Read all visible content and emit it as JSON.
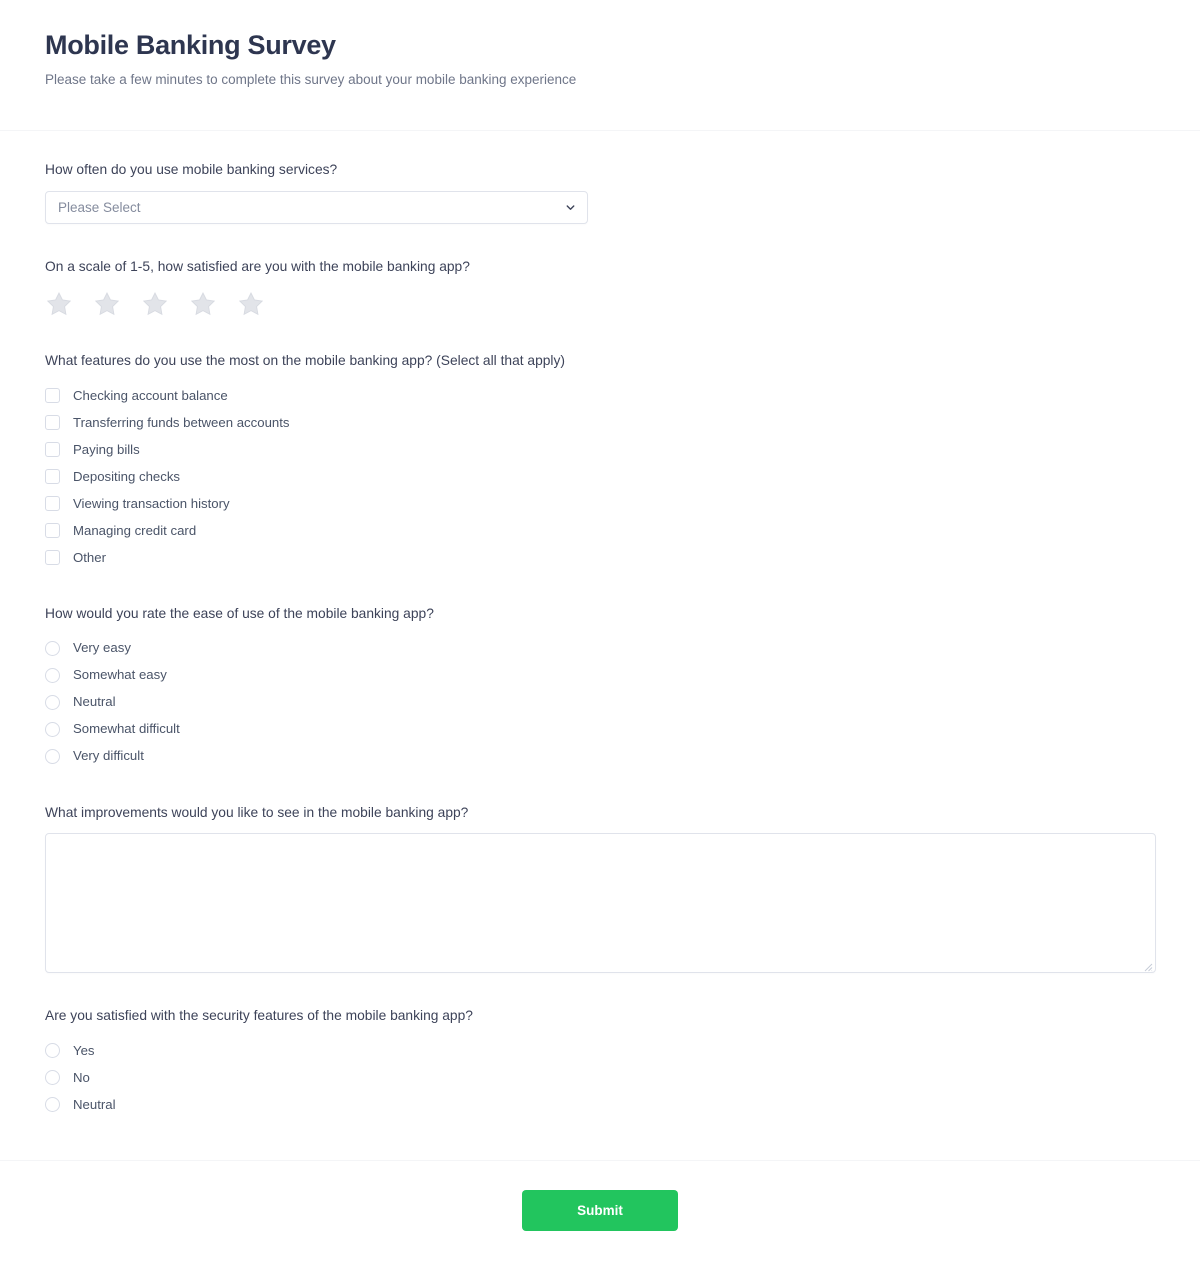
{
  "header": {
    "title": "Mobile Banking Survey",
    "subtitle": "Please take a few minutes to complete this survey about your mobile banking experience"
  },
  "theme": {
    "accent_green": "#22c55e",
    "title_color": "#2e3650",
    "label_color": "#3d4359",
    "option_color": "#4a5468",
    "subtitle_color": "#6f7689",
    "border_color": "#e0e3eb",
    "star_empty_color": "#e2e4e9",
    "placeholder_color": "#858c9e"
  },
  "questions": {
    "frequency": {
      "label": "How often do you use mobile banking services?",
      "placeholder": "Please Select",
      "value": "",
      "icon": "chevron-down-icon"
    },
    "satisfaction": {
      "label": "On a scale of 1-5, how satisfied are you with the mobile banking app?",
      "star_count": 5,
      "rating": 0,
      "max_rating": 5,
      "icon": "star-icon"
    },
    "features": {
      "label": "What features do you use the most on the mobile banking app? (Select all that apply)",
      "options": [
        {
          "label": "Checking account balance",
          "checked": false
        },
        {
          "label": "Transferring funds between accounts",
          "checked": false
        },
        {
          "label": "Paying bills",
          "checked": false
        },
        {
          "label": "Depositing checks",
          "checked": false
        },
        {
          "label": "Viewing transaction history",
          "checked": false
        },
        {
          "label": "Managing credit card",
          "checked": false
        },
        {
          "label": "Other",
          "checked": false
        }
      ]
    },
    "ease_of_use": {
      "label": "How would you rate the ease of use of the mobile banking app?",
      "options": [
        {
          "label": "Very easy",
          "selected": false
        },
        {
          "label": "Somewhat easy",
          "selected": false
        },
        {
          "label": "Neutral",
          "selected": false
        },
        {
          "label": "Somewhat difficult",
          "selected": false
        },
        {
          "label": "Very difficult",
          "selected": false
        }
      ]
    },
    "improvements": {
      "label": "What improvements would you like to see in the mobile banking app?",
      "value": "",
      "placeholder": ""
    },
    "security": {
      "label": "Are you satisfied with the security features of the mobile banking app?",
      "options": [
        {
          "label": "Yes",
          "selected": false
        },
        {
          "label": "No",
          "selected": false
        },
        {
          "label": "Neutral",
          "selected": false
        }
      ]
    }
  },
  "footer": {
    "submit_label": "Submit"
  }
}
